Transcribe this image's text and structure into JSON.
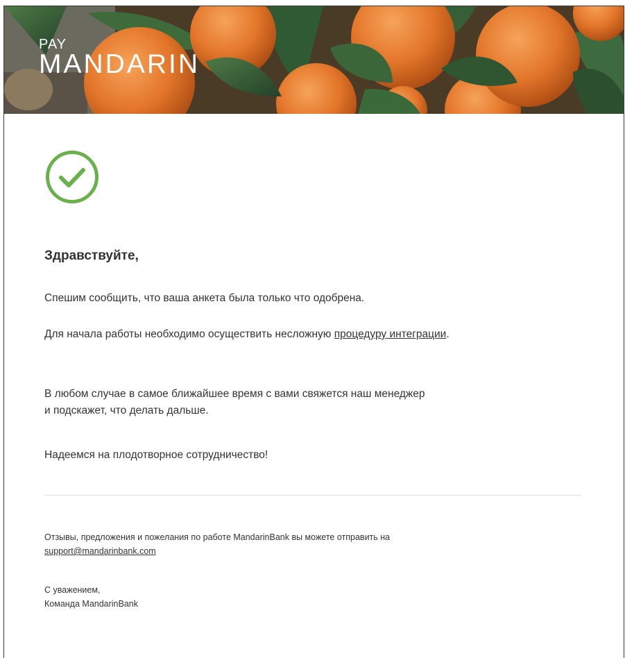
{
  "banner": {
    "brand_small": "PAY",
    "brand_big": "MANDARIN"
  },
  "icon": {
    "name": "check-circle-icon",
    "color": "#6ab04c"
  },
  "greeting": "Здравствуйте,",
  "paragraphs": {
    "p1": "Спешим сообщить, что ваша анкета была только что одобрена.",
    "p2_prefix": "Для начала работы необходимо осуществить несложную ",
    "p2_link": "процедуру интеграции",
    "p2_suffix": ".",
    "p3_line1": "В любом случае в самое ближайшее время с вами свяжется наш менеджер",
    "p3_line2": "и подскажет, что делать дальше.",
    "p4": "Надеемся на плодотворное сотрудничество!"
  },
  "footer": {
    "feedback": "Отзывы, предложения и пожелания по работе MandarinBank вы можете отправить на",
    "email": "support@mandarinbank.com",
    "regards": "С уважением,",
    "signature": "Команда MandarinBank"
  }
}
